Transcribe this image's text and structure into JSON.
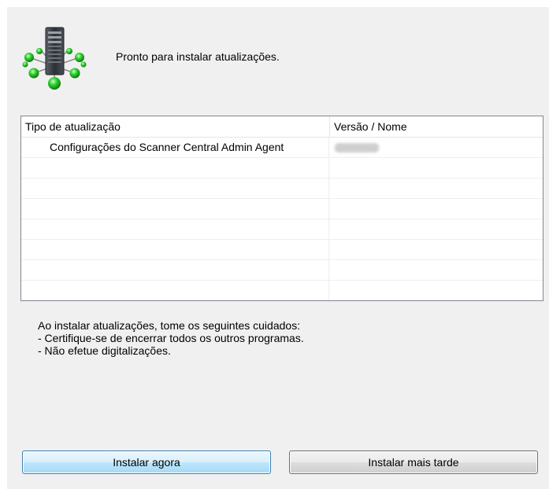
{
  "header": {
    "icon": "server-network-icon",
    "message": "Pronto para instalar atualizações."
  },
  "table": {
    "columns": {
      "type": "Tipo de atualização",
      "version": "Versão / Nome"
    },
    "rows": [
      {
        "type": "Configurações do Scanner Central Admin Agent",
        "version": ""
      },
      {
        "type": "",
        "version": ""
      },
      {
        "type": "",
        "version": ""
      },
      {
        "type": "",
        "version": ""
      },
      {
        "type": "",
        "version": ""
      },
      {
        "type": "",
        "version": ""
      },
      {
        "type": "",
        "version": ""
      },
      {
        "type": "",
        "version": ""
      }
    ]
  },
  "notes": {
    "line1": "Ao instalar atualizações, tome os seguintes cuidados:",
    "line2": "- Certifique-se de encerrar todos os outros programas.",
    "line3": "- Não efetue digitalizações."
  },
  "buttons": {
    "install_now": "Instalar agora",
    "install_later": "Instalar mais tarde"
  },
  "colors": {
    "dialog_background": "#f0f0f0",
    "node_green": "#2ed12e",
    "server_body": "#3a3f46",
    "primary_button_border": "#3c7fb1"
  }
}
